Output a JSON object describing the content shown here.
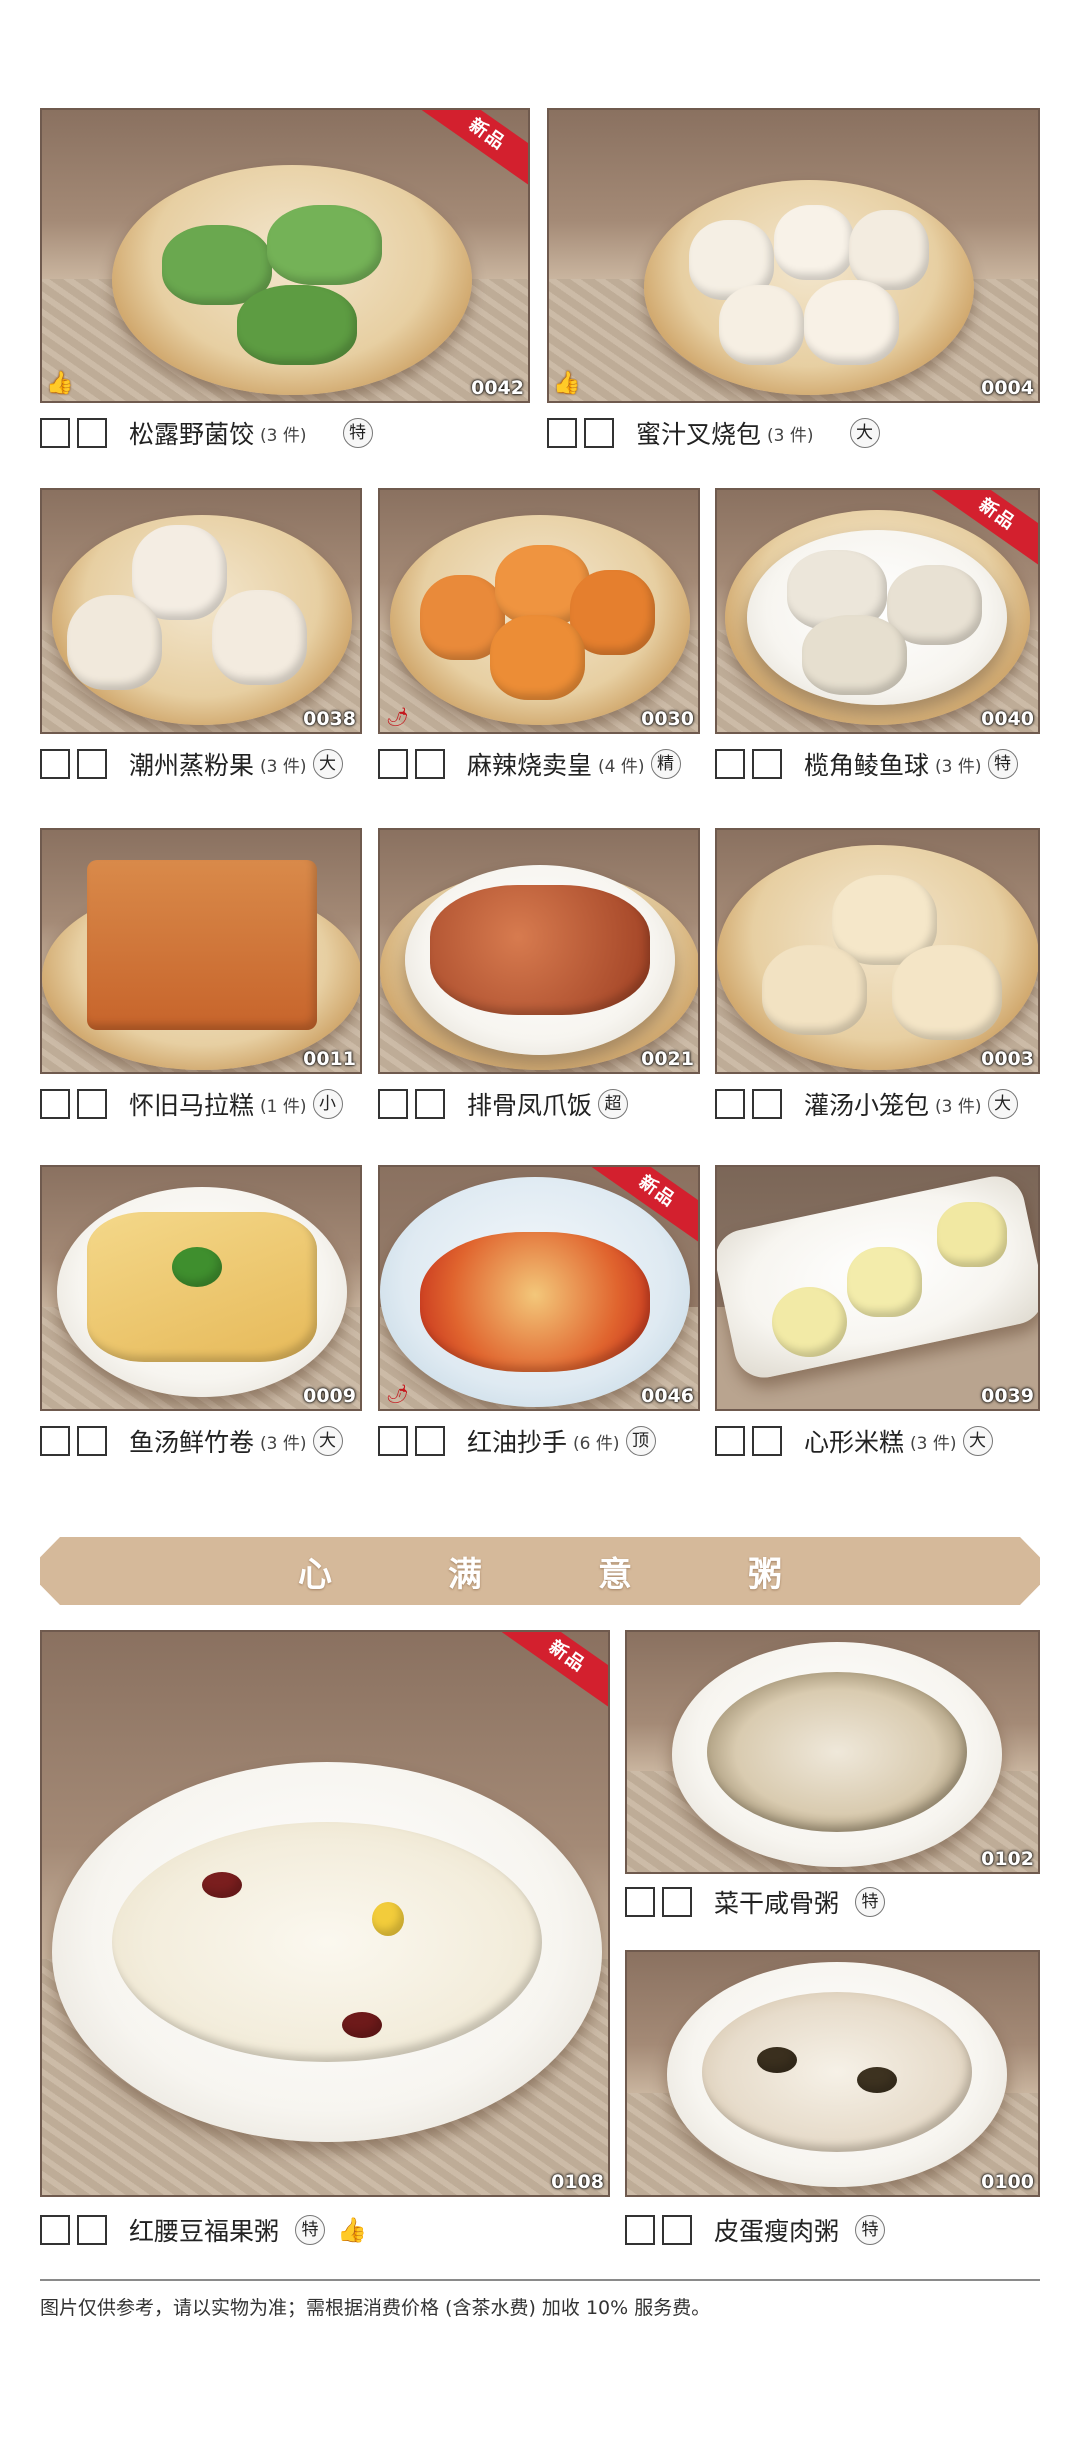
{
  "items_row1": [
    {
      "name": "松露野菌饺",
      "pcs": "(3 件)",
      "badge": "特",
      "code": "0042",
      "ribbon": "新品"
    },
    {
      "name": "蜜汁叉烧包",
      "pcs": "(3 件)",
      "badge": "大",
      "code": "0004"
    }
  ],
  "items_row2": [
    {
      "name": "潮州蒸粉果",
      "pcs": "(3 件)",
      "badge": "大",
      "code": "0038"
    },
    {
      "name": "麻辣烧卖皇",
      "pcs": "(4 件)",
      "badge": "精",
      "code": "0030"
    },
    {
      "name": "榄角鲮鱼球",
      "pcs": "(3 件)",
      "badge": "特",
      "code": "0040",
      "ribbon": "新品"
    }
  ],
  "items_row3": [
    {
      "name": "怀旧马拉糕",
      "pcs": "(1 件)",
      "badge": "小",
      "code": "0011"
    },
    {
      "name": "排骨凤爪饭",
      "pcs": "",
      "badge": "超",
      "code": "0021"
    },
    {
      "name": "灌汤小笼包",
      "pcs": "(3 件)",
      "badge": "大",
      "code": "0003"
    }
  ],
  "items_row4": [
    {
      "name": "鱼汤鲜竹卷",
      "pcs": "(3 件)",
      "badge": "大",
      "code": "0009"
    },
    {
      "name": "红油抄手",
      "pcs": "(6 件)",
      "badge": "顶",
      "code": "0046",
      "ribbon": "新品"
    },
    {
      "name": "心形米糕",
      "pcs": "(3 件)",
      "badge": "大",
      "code": "0039"
    }
  ],
  "section_title_chars": [
    "心",
    "满",
    "意",
    "粥"
  ],
  "congee": [
    {
      "name": "红腰豆福果粥",
      "badge": "特",
      "code": "0108",
      "ribbon": "新品"
    },
    {
      "name": "菜干咸骨粥",
      "badge": "特",
      "code": "0102"
    },
    {
      "name": "皮蛋瘦肉粥",
      "badge": "特",
      "code": "0100"
    }
  ],
  "footnote": "图片仅供参考，请以实物为准；需根据消费价格 (含茶水费) 加收 10% 服务费。",
  "colors": {
    "ribbon": "#d3202e",
    "banner": "#d5b99a",
    "photo_border": "#6f5a4e"
  },
  "icons": {
    "recommend": "thumbs-up-icon",
    "spicy": "chili-icon"
  }
}
